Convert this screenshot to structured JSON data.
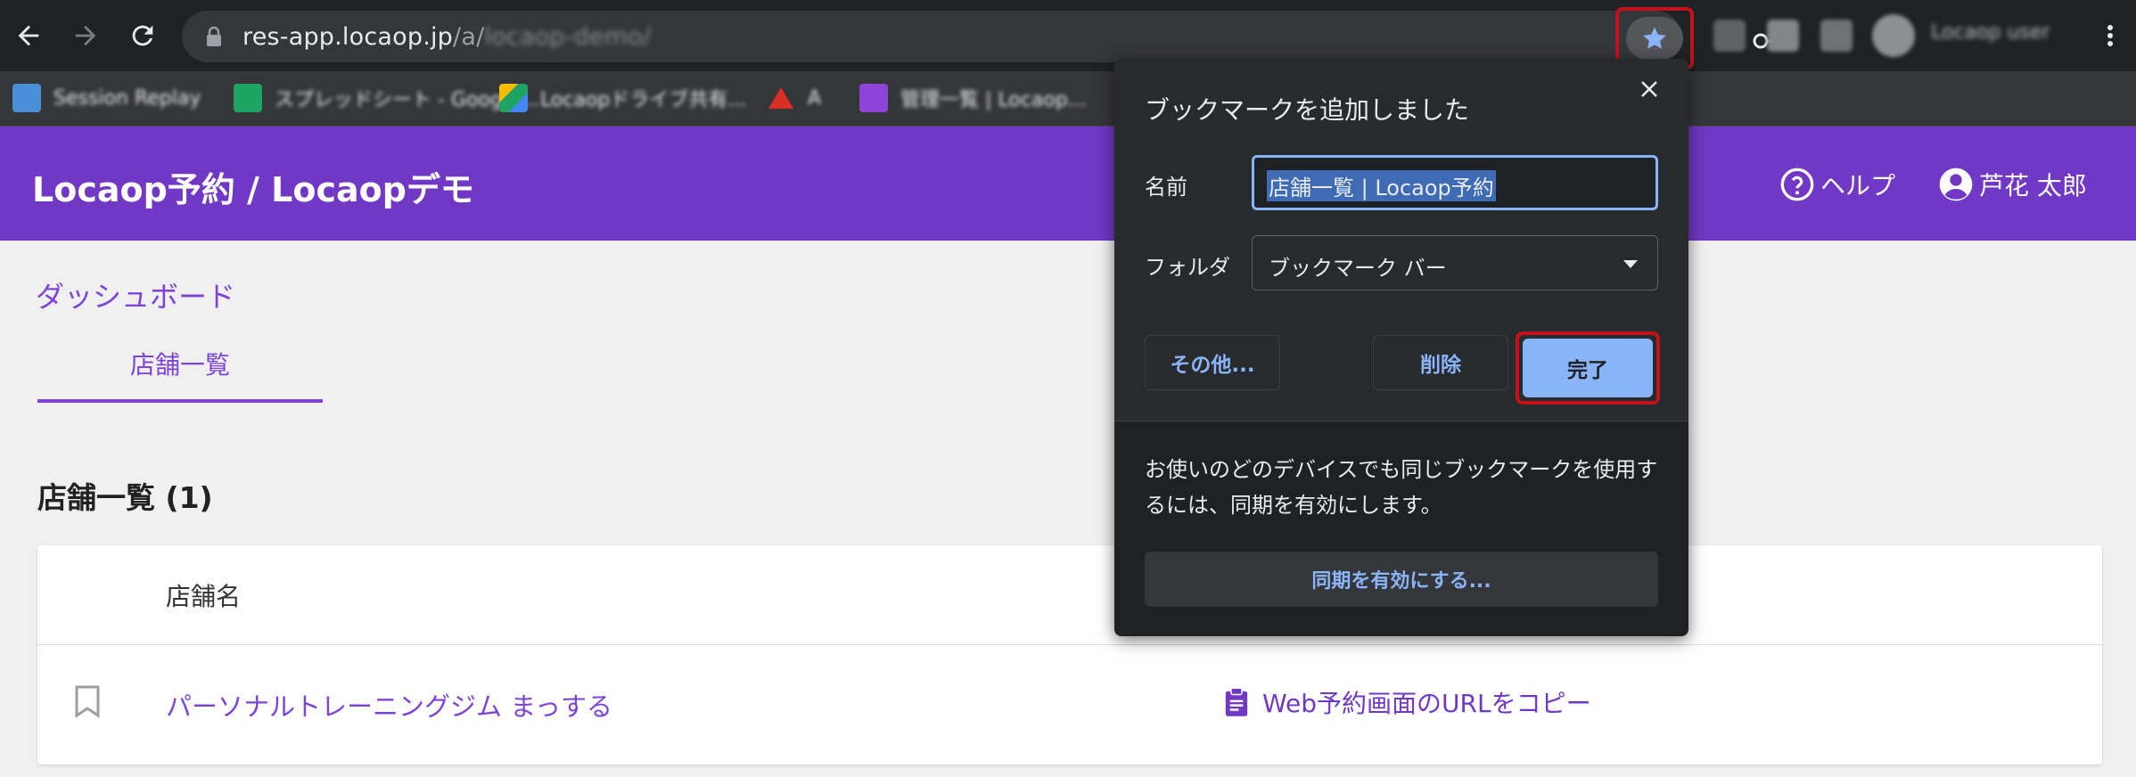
{
  "browser": {
    "url_host": "res-app.locaop.jp",
    "url_path": "/a/",
    "url_path_obscured": "locaop-demo/",
    "profile_name_obscured": "Locaop user",
    "bookmarks_bar": [
      {
        "label": "Session Replay",
        "icon": "blue-square-icon",
        "color": "#4a90d9"
      },
      {
        "label": "スプレッドシート - Google...",
        "icon": "sheets-icon",
        "color": "#1ea362"
      },
      {
        "label": "Locaopドライブ共有...",
        "icon": "drive-icon",
        "color": "#fbbc04"
      },
      {
        "label": "A",
        "icon": "red-triangle-icon",
        "color": "#d93025"
      },
      {
        "label": "管理一覧 | Locaop...",
        "icon": "purple-grid-icon",
        "color": "#8e44d6"
      }
    ]
  },
  "app": {
    "title": "Locaop予約 / Locaopデモ",
    "help_label": "ヘルプ",
    "user_name": "芦花 太郎",
    "breadcrumb": "ダッシュボード",
    "tab_label": "店舗一覧",
    "section_title": "店舗一覧 (1)",
    "table": {
      "column_store_name": "店舗名",
      "rows": [
        {
          "store_name": "パーソナルトレーニングジム まっする",
          "action": "Web予約画面のURLをコピー"
        }
      ]
    }
  },
  "dialog": {
    "title": "ブックマークを追加しました",
    "name_label": "名前",
    "name_value": "店舗一覧 | Locaop予約",
    "folder_label": "フォルダ",
    "folder_value": "ブックマーク バー",
    "more_button": "その他...",
    "delete_button": "削除",
    "done_button": "完了",
    "sync_message": "お使いのどのデバイスでも同じブックマークを使用するには、同期を有効にします。",
    "sync_button": "同期を有効にする..."
  },
  "colors": {
    "brand_purple": "#7038c4",
    "link_purple": "#7e44d6",
    "dialog_bg": "#292a2d",
    "accent_blue": "#8ab4f8",
    "highlight_red": "#c0131a"
  }
}
